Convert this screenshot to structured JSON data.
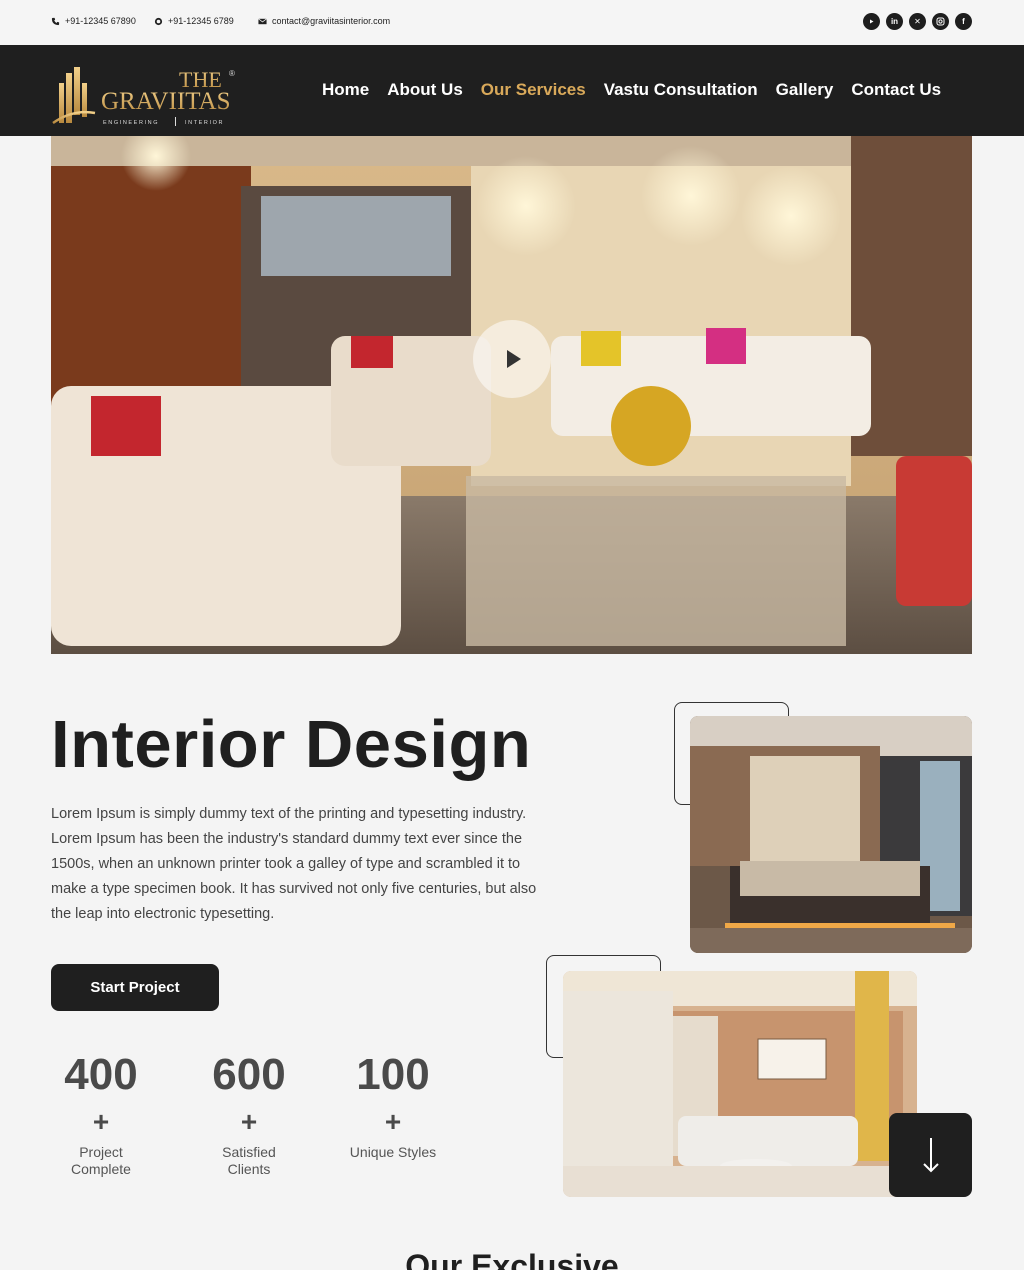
{
  "topbar": {
    "phone1": "+91-12345 67890",
    "phone2": "+91-12345 6789",
    "email": "contact@graviitasinterior.com",
    "socials": [
      "youtube-icon",
      "linkedin-icon",
      "x-icon",
      "instagram-icon",
      "facebook-icon"
    ]
  },
  "logo": {
    "line1": "THE",
    "line2": "GRAVIITAS",
    "left_tag": "ENGINEERING",
    "right_tag": "INTERIOR",
    "mark": "®"
  },
  "nav": {
    "items": [
      "Home",
      "About Us",
      "Our Services",
      "Vastu Consultation",
      "Gallery",
      "Contact Us"
    ],
    "active": "Our Services"
  },
  "section": {
    "title": "Interior Design",
    "description": "Lorem Ipsum is simply dummy text of the printing and typesetting industry. Lorem Ipsum has been the industry's standard dummy text ever since the 1500s, when an unknown printer took a galley of type and scrambled it to make a type specimen book. It has survived not only five centuries, but also the leap into electronic typesetting.",
    "button": "Start Project"
  },
  "stats": [
    {
      "num": "400",
      "plus": "+",
      "line1": "Project",
      "line2": "Complete"
    },
    {
      "num": "600",
      "plus": "+",
      "line1": "Satisfied",
      "line2": "Clients"
    },
    {
      "num": "100",
      "plus": "+",
      "line1": "Unique Styles",
      "line2": ""
    }
  ],
  "next_section_title": "Our Exclusive",
  "colors": {
    "dark": "#1f1f1f",
    "accent_gold": "#d9a95a",
    "page_bg": "#f4f4f4"
  }
}
